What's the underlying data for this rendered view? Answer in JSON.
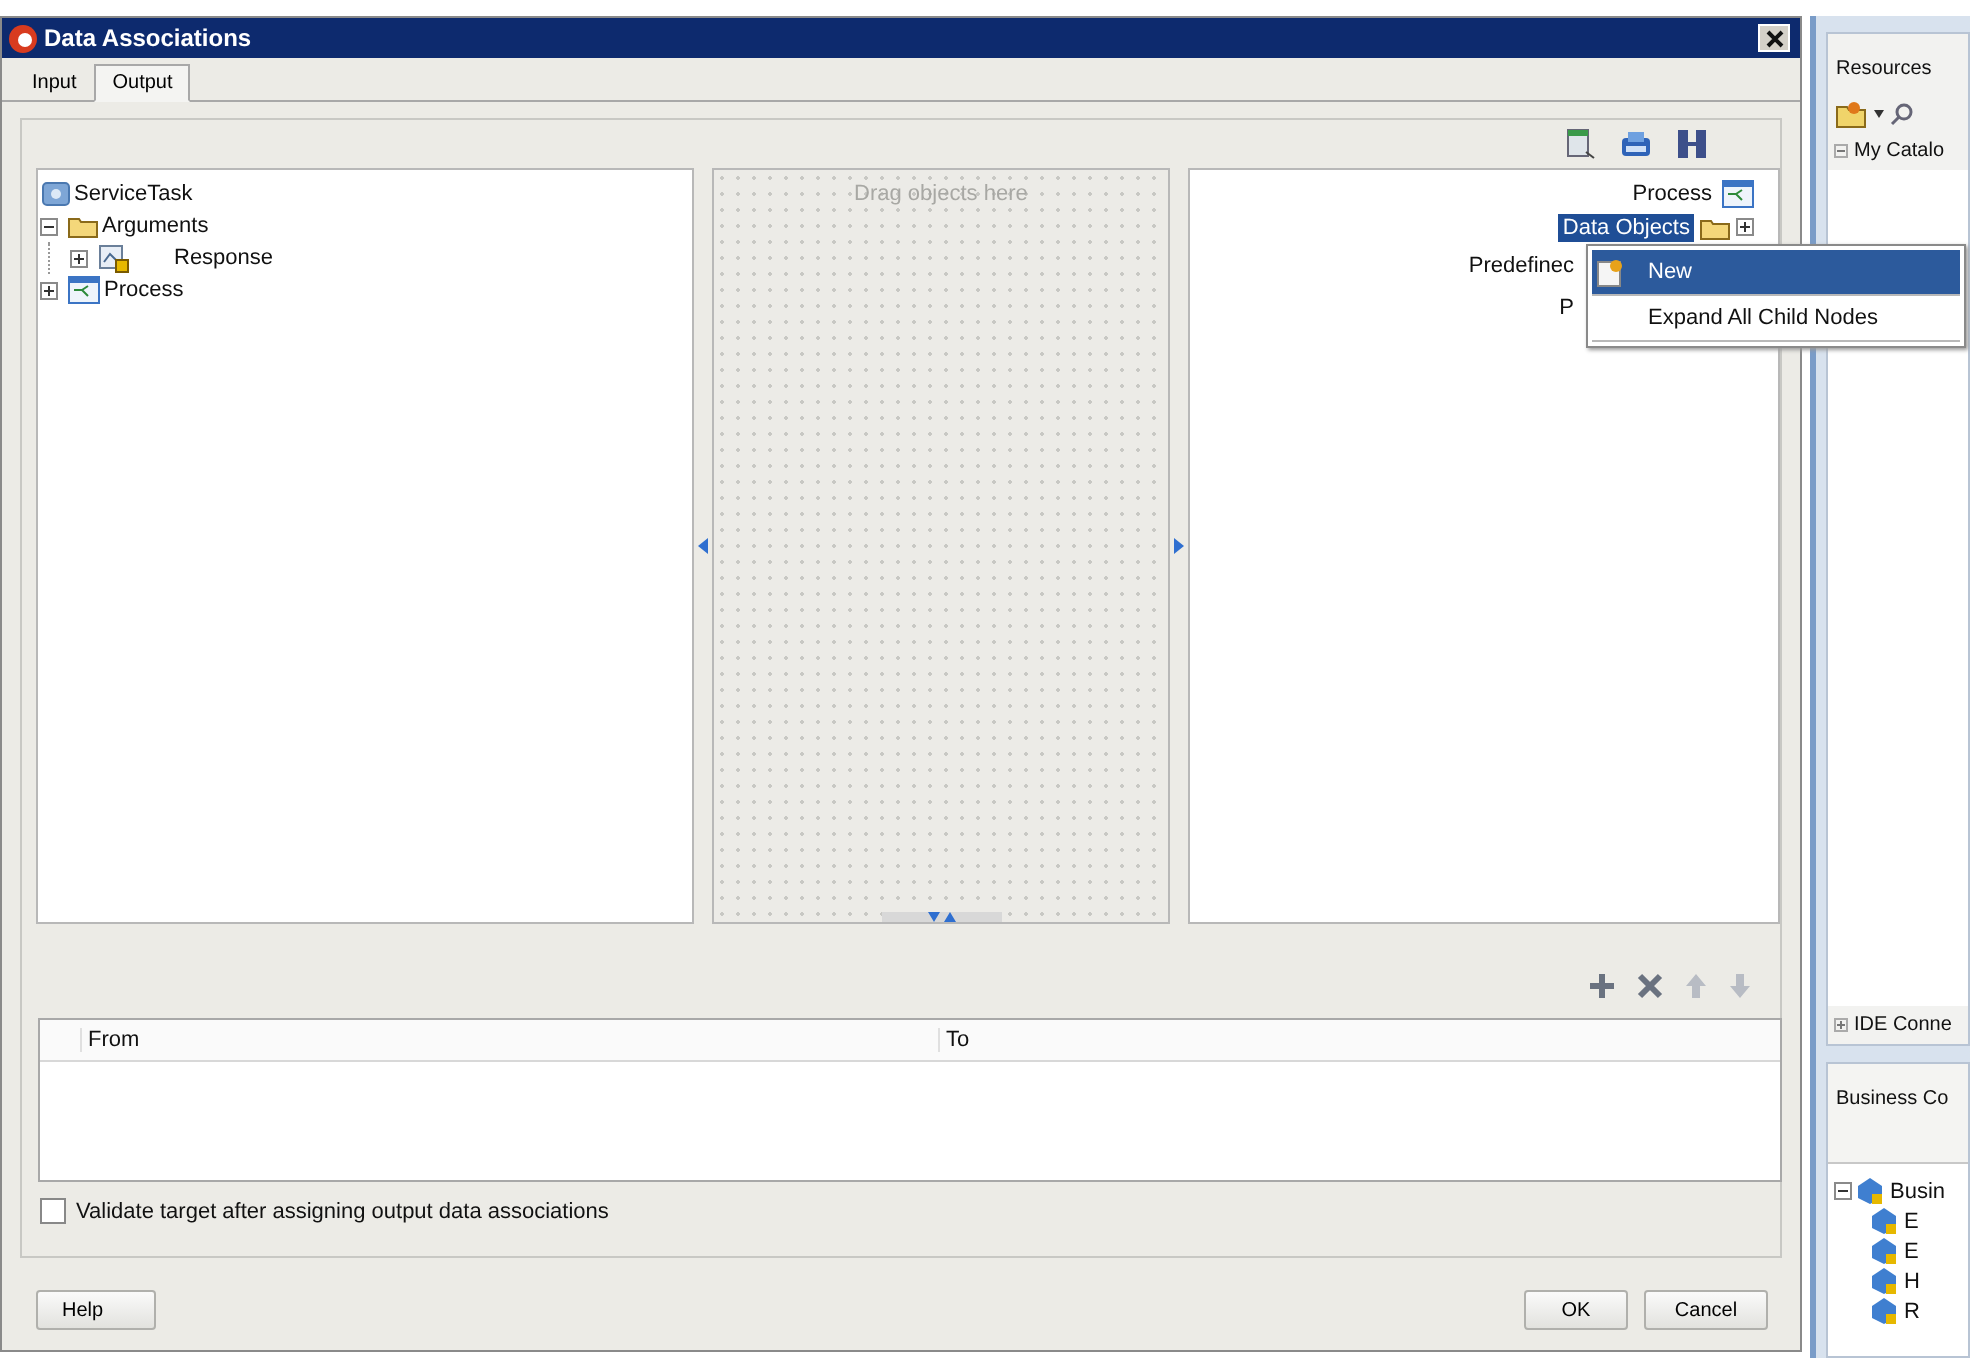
{
  "dialog": {
    "title": "Data Associations"
  },
  "tabs": [
    {
      "label": "Input",
      "selected": false
    },
    {
      "label": "Output",
      "selected": true
    }
  ],
  "source_tree": [
    {
      "label": "ServiceTask",
      "kind": "task",
      "children": [
        {
          "label": "Arguments",
          "kind": "folder",
          "expanded": true,
          "children": [
            {
              "label": "Response",
              "kind": "argument",
              "expanded": false
            }
          ]
        },
        {
          "label": "Process",
          "kind": "process",
          "expanded": false
        }
      ]
    }
  ],
  "mapping_area": {
    "placeholder": "Drag objects here"
  },
  "target_tree": [
    {
      "label": "Process",
      "kind": "process",
      "selected": false
    },
    {
      "label": "Data Objects",
      "kind": "folder",
      "selected": true
    },
    {
      "label": "Predefinec",
      "kind": "none",
      "selected": false
    },
    {
      "label": "P",
      "kind": "none",
      "selected": false
    }
  ],
  "context_menu": [
    {
      "label": "New",
      "kind": "new",
      "selected": true
    },
    {
      "label": "Expand All Child Nodes",
      "kind": "plain",
      "selected": false
    }
  ],
  "table": {
    "columns": [
      "From",
      "To"
    ]
  },
  "validate": {
    "label": "Validate target after assigning output data associations",
    "checked": false
  },
  "buttons": {
    "help": "Help",
    "ok": "OK",
    "cancel": "Cancel"
  },
  "side_panel": {
    "title": "Resources",
    "catalog": "My Catalo",
    "connections": "IDE Conne",
    "business_header": "Business Co",
    "business_tree": {
      "label": "Busin",
      "children": [
        "E",
        "E",
        "H",
        "R"
      ]
    }
  }
}
